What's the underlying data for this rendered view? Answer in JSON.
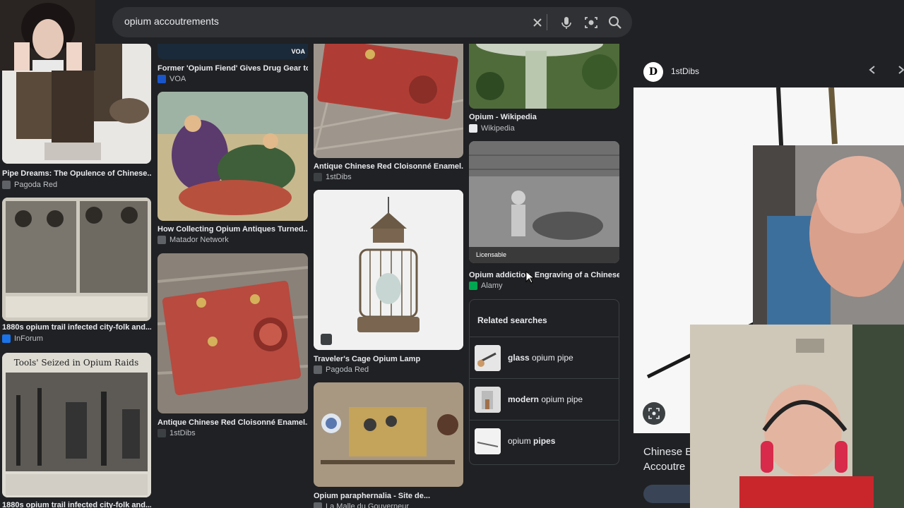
{
  "search": {
    "value": "opium accoutrements",
    "clear_icon": "close-icon",
    "voice_icon": "mic-icon",
    "lens_icon": "lens-icon",
    "search_icon": "search-icon"
  },
  "results": [
    {
      "title": "Pipe Dreams: The Opulence of Chinese...",
      "source": "Pagoda Red",
      "favicon_color": "#3c4043"
    },
    {
      "title": "1880s opium trail infected city-folk and...",
      "source": "InForum",
      "favicon_color": "#1a73e8"
    },
    {
      "title": "1880s opium trail infected city-folk and...",
      "source": ""
    },
    {
      "title": "Former 'Opium Fiend' Gives Drug Gear to...",
      "source": "VOA",
      "favicon_color": "#1a56c9"
    },
    {
      "title": "How Collecting Opium Antiques Turned...",
      "source": "Matador Network",
      "favicon_color": "#5f6368"
    },
    {
      "title": "Antique Chinese Red Cloisonné Enamel...",
      "source": "1stDibs",
      "favicon_color": "#3c4043"
    },
    {
      "title": "Antique Chinese Red Cloisonné Enamel...",
      "source": "1stDibs",
      "favicon_color": "#3c4043"
    },
    {
      "title": "Traveler's Cage Opium Lamp",
      "source": "Pagoda Red",
      "favicon_color": "#3c4043"
    },
    {
      "title": "Opium paraphernalia - Site de...",
      "source": "La Malle du Gouverneur",
      "favicon_color": "#5f6368"
    },
    {
      "title": "Opium - Wikipedia",
      "source": "Wikipedia",
      "favicon_color": "#e8eaed"
    },
    {
      "title": "Opium addiction, Engraving of a Chinese...",
      "source": "Alamy",
      "favicon_color": "#00a651",
      "badge": "Licensable"
    }
  ],
  "newspaper": {
    "headline": "Tools' Seized in Opium Raids"
  },
  "related": {
    "title": "Related searches",
    "items": [
      {
        "bold": "glass",
        "rest": " opium pipe"
      },
      {
        "bold": "modern",
        "rest": " opium pipe"
      },
      {
        "bold": "",
        "rest": "opium ",
        "bold2": "pipes"
      }
    ]
  },
  "side_panel": {
    "logo": "D",
    "source": "1stDibs",
    "title": "Chinese E Accoutre",
    "prev_icon": "chevron-left-icon",
    "next_icon": "chevron-right-icon"
  },
  "watermark": "VOA"
}
